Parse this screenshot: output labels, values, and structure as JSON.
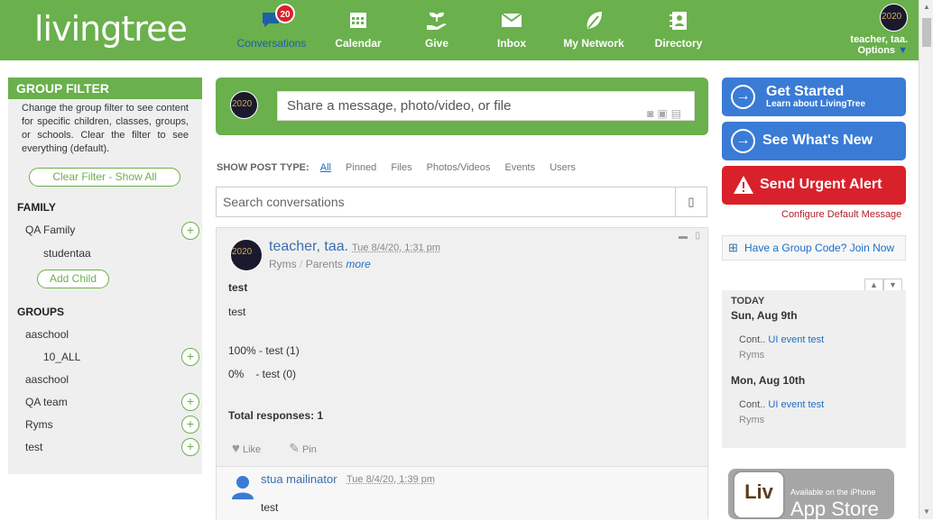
{
  "logo": {
    "text_a": "living",
    "text_b": "tree"
  },
  "nav": [
    {
      "label": "Conversations",
      "icon": "chat-icon",
      "badge": "20",
      "active": true
    },
    {
      "label": "Calendar",
      "icon": "calendar-icon"
    },
    {
      "label": "Give",
      "icon": "hand-plant-icon"
    },
    {
      "label": "Inbox",
      "icon": "envelope-icon"
    },
    {
      "label": "My Network",
      "icon": "leaf-icon"
    },
    {
      "label": "Directory",
      "icon": "contact-card-icon"
    }
  ],
  "user": {
    "name": "teacher, taa.",
    "options": "Options"
  },
  "group_filter": {
    "title": "GROUP FILTER",
    "description": "Change the group filter to see content for specific children, classes, groups, or schools. Clear the filter to see everything (default).",
    "clear": "Clear Filter - Show All",
    "family_heading": "FAMILY",
    "family": [
      "QA Family",
      "studentaa"
    ],
    "add_child": "Add Child",
    "groups_heading": "GROUPS",
    "groups": [
      "aaschool",
      "10_ALL",
      "aaschool",
      "QA team",
      "Ryms",
      "test"
    ]
  },
  "composer": {
    "placeholder": "Share a message, photo/video, or file"
  },
  "post_type": {
    "label": "SHOW POST TYPE:",
    "options": [
      "All",
      "Pinned",
      "Files",
      "Photos/Videos",
      "Events",
      "Users"
    ]
  },
  "search": {
    "placeholder": "Search conversations"
  },
  "post": {
    "author": "teacher, taa.",
    "date": "Tue 8/4/20, 1:31 pm",
    "group": "Ryms",
    "sep": "/",
    "audience": "Parents",
    "more": "more",
    "title": "test",
    "body": "test",
    "poll": [
      {
        "pct": "100%",
        "label": "- test (1)"
      },
      {
        "pct": "0%",
        "label": "- test (0)"
      }
    ],
    "total": "Total responses: 1",
    "like": "Like",
    "pin": "Pin",
    "reply_author": "stua mailinator",
    "reply_date": "Tue 8/4/20, 1:39 pm",
    "reply_body": "test"
  },
  "right": {
    "get_started": "Get Started",
    "get_started_sub": "Learn about LivingTree",
    "whats_new": "See What's New",
    "urgent": "Send Urgent Alert",
    "configure": "Configure Default Message",
    "group_code": "Have a Group Code? Join Now",
    "today": "TODAY",
    "day1": "Sun, Aug 9th",
    "day2": "Mon, Aug 10th",
    "event_prefix": "Cont..",
    "event_name": "UI event test",
    "event_group": "Ryms",
    "store_small": "Available on the iPhone",
    "store_big": "App Store",
    "store_logo": "Liv"
  },
  "colors": {
    "green": "#6ab04c",
    "blue": "#3a7bd5",
    "red": "#d9212b"
  }
}
